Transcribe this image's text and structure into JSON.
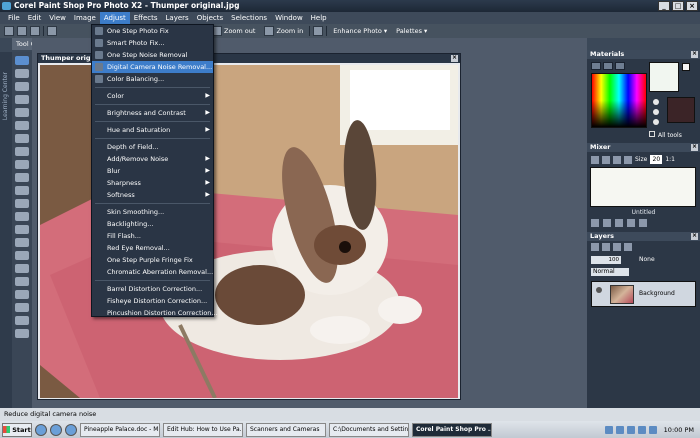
{
  "window": {
    "title": "Corel Paint Shop Pro Photo X2 - Thumper original.jpg",
    "controls": [
      "_",
      "□",
      "×"
    ]
  },
  "menubar": [
    "File",
    "Edit",
    "View",
    "Image",
    "Adjust",
    "Effects",
    "Layers",
    "Objects",
    "Selections",
    "Window",
    "Help"
  ],
  "toolbar": {
    "zoom_out": "Zoom out",
    "zoom_in": "Zoom in",
    "enhance_photo": "Enhance Photo",
    "palettes": "Palettes"
  },
  "tool_options_tab": "Tool Options - Pan To",
  "left_palette_label": "Learning Center",
  "image_window": {
    "title": "Thumper orig"
  },
  "adjust_menu": {
    "items": [
      {
        "label": "One Step Photo Fix",
        "icon": true
      },
      {
        "label": "Smart Photo Fix...",
        "icon": true
      },
      {
        "label": "One Step Noise Removal",
        "icon": true
      },
      {
        "label": "Digital Camera Noise Removal...",
        "icon": true,
        "highlight": true
      },
      {
        "label": "Color Balancing...",
        "icon": true
      },
      {
        "sep": true
      },
      {
        "label": "Color",
        "sub": true
      },
      {
        "sep": true
      },
      {
        "label": "Brightness and Contrast",
        "sub": true
      },
      {
        "sep": true
      },
      {
        "label": "Hue and Saturation",
        "sub": true
      },
      {
        "sep": true
      },
      {
        "label": "Depth of Field..."
      },
      {
        "label": "Add/Remove Noise",
        "sub": true
      },
      {
        "label": "Blur",
        "sub": true
      },
      {
        "label": "Sharpness",
        "sub": true
      },
      {
        "label": "Softness",
        "sub": true
      },
      {
        "sep": true
      },
      {
        "label": "Skin Smoothing..."
      },
      {
        "label": "Backlighting..."
      },
      {
        "label": "Fill Flash..."
      },
      {
        "label": "Red Eye Removal..."
      },
      {
        "label": "One Step Purple Fringe Fix"
      },
      {
        "label": "Chromatic Aberration Removal..."
      },
      {
        "sep": true
      },
      {
        "label": "Barrel Distortion Correction..."
      },
      {
        "label": "Fisheye Distortion Correction..."
      },
      {
        "label": "Pincushion Distortion Correction..."
      }
    ]
  },
  "materials": {
    "title": "Materials",
    "all_tools": "All tools"
  },
  "mixer": {
    "title": "Mixer",
    "size": "20",
    "zoom": "1:1",
    "status": "Untitled"
  },
  "layers": {
    "title": "Layers",
    "opacity": "100",
    "none_label": "None",
    "blend": "Normal",
    "layer_name": "Background"
  },
  "status_text": "Reduce digital camera noise",
  "taskbar": {
    "start": "Start",
    "tasks": [
      "Pineapple Palace.doc - M...",
      "Edit Hub: How to Use Pa...",
      "Scanners and Cameras",
      "C:\\Documents and Settin...",
      "Corel Paint Shop Pro ..."
    ],
    "clock": "10:00 PM"
  }
}
